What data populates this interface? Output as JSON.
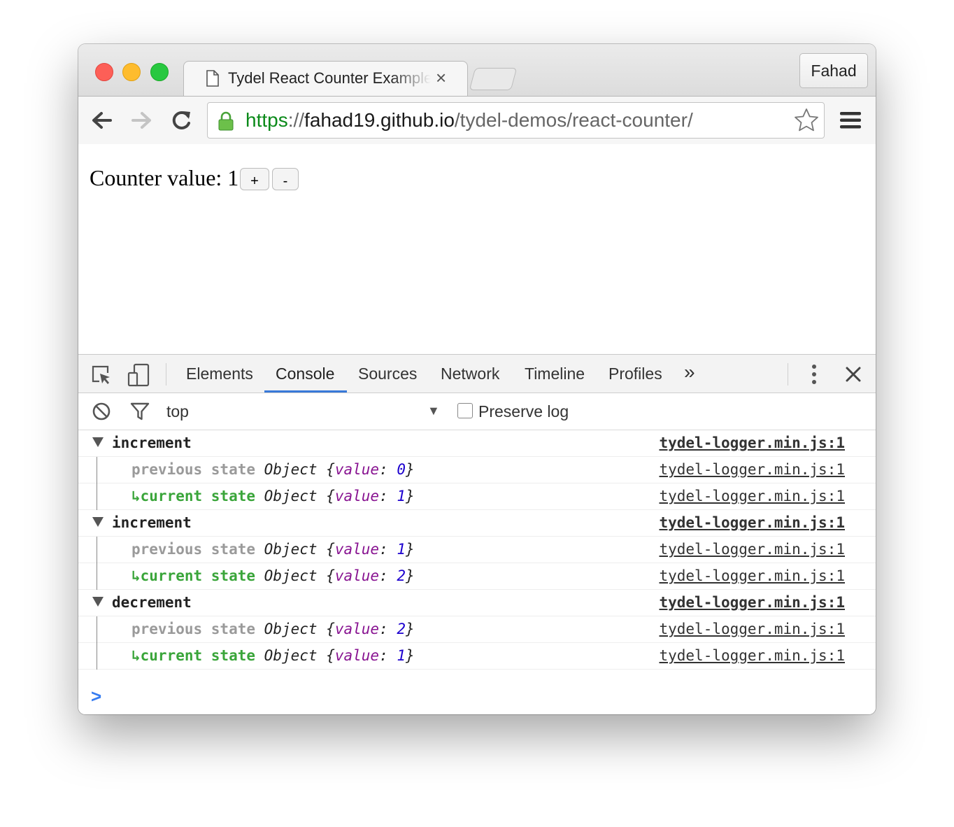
{
  "browser": {
    "tab_title": "Tydel React Counter Example",
    "tab_close": "×",
    "profile_name": "Fahad",
    "url_scheme": "https",
    "url_sep": "://",
    "url_host": "fahad19.github.io",
    "url_path": "/tydel-demos/react-counter/"
  },
  "page": {
    "counter_label": "Counter value:",
    "counter_value": "1",
    "increment_label": "+",
    "decrement_label": "-"
  },
  "devtools": {
    "tabs": [
      {
        "label": "Elements"
      },
      {
        "label": "Console"
      },
      {
        "label": "Sources"
      },
      {
        "label": "Network"
      },
      {
        "label": "Timeline"
      },
      {
        "label": "Profiles"
      }
    ],
    "more_tabs": "»",
    "active_tab": "Console",
    "context": "top",
    "preserve_log_label": "Preserve log",
    "preserve_log_checked": false,
    "prompt": ">"
  },
  "console": {
    "groups": [
      {
        "label": "increment",
        "source": "tydel-logger.min.js:1",
        "previous": {
          "label": "previous state",
          "type": "Object",
          "key": "value",
          "value": "0",
          "source": "tydel-logger.min.js:1"
        },
        "current": {
          "label": "↳current state",
          "type": "Object",
          "key": "value",
          "value": "1",
          "source": "tydel-logger.min.js:1"
        }
      },
      {
        "label": "increment",
        "source": "tydel-logger.min.js:1",
        "previous": {
          "label": "previous state",
          "type": "Object",
          "key": "value",
          "value": "1",
          "source": "tydel-logger.min.js:1"
        },
        "current": {
          "label": "↳current state",
          "type": "Object",
          "key": "value",
          "value": "2",
          "source": "tydel-logger.min.js:1"
        }
      },
      {
        "label": "decrement",
        "source": "tydel-logger.min.js:1",
        "previous": {
          "label": "previous state",
          "type": "Object",
          "key": "value",
          "value": "2",
          "source": "tydel-logger.min.js:1"
        },
        "current": {
          "label": "↳current state",
          "type": "Object",
          "key": "value",
          "value": "1",
          "source": "tydel-logger.min.js:1"
        }
      }
    ]
  }
}
